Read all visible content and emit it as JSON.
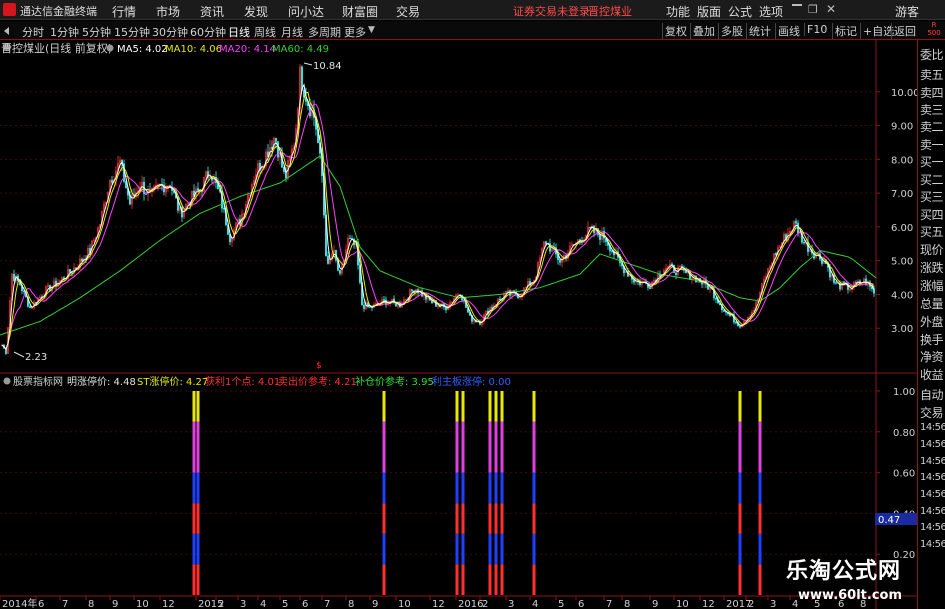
{
  "window": {
    "app_name": "通达信金融终端",
    "menu": [
      "行情",
      "市场",
      "资讯",
      "发现",
      "问小达",
      "财富圈",
      "交易"
    ],
    "warning": "证券交易未登录",
    "warning_stock": "晋控煤业",
    "right_menu": [
      "功能",
      "版面",
      "公式",
      "选项"
    ],
    "guest": "游客"
  },
  "toolbar": {
    "periods": [
      "分时",
      "1分钟",
      "5分钟",
      "15分钟",
      "30分钟",
      "60分钟",
      "日线",
      "周线",
      "月线",
      "多周期",
      "更多"
    ],
    "active_period": "日线",
    "right_buttons": [
      "复权",
      "叠加",
      "多股",
      "统计",
      "画线",
      "F10",
      "标记",
      "+自选",
      "返回"
    ],
    "corner_top": "R",
    "corner_bottom": "500"
  },
  "main_legend": {
    "stock": "晋控煤业(日线 前复权)",
    "ma5": "MA5: 4.02",
    "ma10": "MA10: 4.06",
    "ma20": "MA20: 4.14",
    "ma60": "MA60: 4.49"
  },
  "main_annotations": {
    "high": "10.84",
    "low": "2.23"
  },
  "sub_legend": {
    "name": "股票指标网",
    "items": [
      {
        "text": "明涨停价: 4.48",
        "color": "#e0e0e0"
      },
      {
        "text": "ST涨停价: 4.27",
        "color": "#e8e800"
      },
      {
        "text": "获利1个点: 4.01",
        "color": "#ff3030"
      },
      {
        "text": "卖出价参考: 4.21",
        "color": "#ff3030"
      },
      {
        "text": "补仓价参考: 3.95",
        "color": "#30e030"
      },
      {
        "text": "利主板涨停: 0.00",
        "color": "#3060ff"
      }
    ]
  },
  "sub_value_label": "0.47",
  "main_y_ticks": [
    "10.00",
    "9.00",
    "8.00",
    "7.00",
    "6.00",
    "5.00",
    "4.00",
    "3.00"
  ],
  "sub_y_ticks": [
    "1.00",
    "0.80",
    "0.60",
    "0.40",
    "0.20"
  ],
  "x_labels": [
    "2014年",
    "6",
    "7",
    "8",
    "9",
    "10",
    "12",
    "2015",
    "2",
    "3",
    "4",
    "5",
    "6",
    "7",
    "8",
    "9",
    "10",
    "12",
    "2016",
    "2",
    "3",
    "4",
    "5",
    "6",
    "7",
    "8",
    "9",
    "10",
    "12",
    "2017",
    "2",
    "3",
    "4",
    "5",
    "6",
    "8"
  ],
  "side_panel": {
    "items": [
      "委比",
      "卖五",
      "卖四",
      "卖三",
      "卖二",
      "卖一",
      "买一",
      "买二",
      "买三",
      "买四",
      "买五",
      "现价",
      "涨跌",
      "涨幅",
      "总量",
      "外盘",
      "换手",
      "净资",
      "收益",
      "自动",
      "交易",
      "14:56",
      "14:56",
      "14:56",
      "14:56",
      "14:56",
      "14:56",
      "14:56",
      "14:56"
    ]
  },
  "watermark": {
    "cn": "乐淘公式网",
    "url": "www.60lt.com"
  },
  "colors": {
    "axis_red": "#8b1515",
    "ma5": "#ffffff",
    "ma10": "#e8e800",
    "ma20": "#ff40ff",
    "ma60": "#30d030",
    "candle_up": "#ff3030",
    "candle_down": "#30ffff",
    "stripe_blue": "#2040ff"
  },
  "chart_data": [
    {
      "type": "candlestick",
      "title": "晋控煤业(日线 前复权)",
      "y_range": [
        2.0,
        11.0
      ],
      "annotations": [
        {
          "label": "10.84",
          "value": 10.84
        },
        {
          "label": "2.23",
          "value": 2.23
        }
      ],
      "close_path": [
        [
          0,
          2.6
        ],
        [
          6,
          2.3
        ],
        [
          12,
          4.6
        ],
        [
          20,
          4.3
        ],
        [
          30,
          3.6
        ],
        [
          45,
          4.1
        ],
        [
          60,
          4.4
        ],
        [
          75,
          4.8
        ],
        [
          90,
          5.3
        ],
        [
          100,
          6.1
        ],
        [
          110,
          7.4
        ],
        [
          120,
          7.9
        ],
        [
          130,
          6.7
        ],
        [
          140,
          7.3
        ],
        [
          150,
          6.9
        ],
        [
          160,
          7.2
        ],
        [
          170,
          7.3
        ],
        [
          180,
          6.4
        ],
        [
          190,
          6.8
        ],
        [
          200,
          7.1
        ],
        [
          210,
          7.7
        ],
        [
          220,
          6.9
        ],
        [
          230,
          5.7
        ],
        [
          240,
          6.2
        ],
        [
          255,
          7.6
        ],
        [
          265,
          8.1
        ],
        [
          275,
          8.7
        ],
        [
          285,
          7.4
        ],
        [
          295,
          8.6
        ],
        [
          300,
          10.5
        ],
        [
          308,
          9.7
        ],
        [
          315,
          9.2
        ],
        [
          322,
          7.5
        ],
        [
          327,
          4.7
        ],
        [
          333,
          5.3
        ],
        [
          340,
          4.5
        ],
        [
          348,
          5.6
        ],
        [
          356,
          5.4
        ],
        [
          362,
          3.7
        ],
        [
          370,
          3.6
        ],
        [
          385,
          3.8
        ],
        [
          400,
          3.7
        ],
        [
          415,
          4.2
        ],
        [
          430,
          3.8
        ],
        [
          445,
          3.6
        ],
        [
          460,
          4.1
        ],
        [
          470,
          3.3
        ],
        [
          480,
          3.2
        ],
        [
          490,
          3.6
        ],
        [
          505,
          4.0
        ],
        [
          520,
          4.0
        ],
        [
          535,
          4.5
        ],
        [
          545,
          5.6
        ],
        [
          560,
          5.0
        ],
        [
          575,
          5.5
        ],
        [
          590,
          5.9
        ],
        [
          605,
          5.7
        ],
        [
          620,
          4.9
        ],
        [
          635,
          4.4
        ],
        [
          650,
          4.3
        ],
        [
          665,
          4.8
        ],
        [
          680,
          4.7
        ],
        [
          695,
          4.5
        ],
        [
          710,
          4.2
        ],
        [
          725,
          3.5
        ],
        [
          740,
          3.1
        ],
        [
          755,
          3.6
        ],
        [
          765,
          4.5
        ],
        [
          775,
          5.2
        ],
        [
          785,
          5.7
        ],
        [
          795,
          6.1
        ],
        [
          805,
          5.5
        ],
        [
          815,
          5.2
        ],
        [
          825,
          5.0
        ],
        [
          835,
          4.3
        ],
        [
          850,
          4.2
        ],
        [
          865,
          4.4
        ],
        [
          876,
          4.0
        ]
      ],
      "ma60_path": [
        [
          0,
          2.8
        ],
        [
          40,
          3.2
        ],
        [
          80,
          3.9
        ],
        [
          120,
          4.7
        ],
        [
          160,
          5.6
        ],
        [
          200,
          6.4
        ],
        [
          240,
          6.9
        ],
        [
          280,
          7.3
        ],
        [
          305,
          7.8
        ],
        [
          320,
          8.1
        ],
        [
          340,
          7.2
        ],
        [
          360,
          5.4
        ],
        [
          380,
          4.7
        ],
        [
          420,
          4.2
        ],
        [
          460,
          3.9
        ],
        [
          500,
          4.0
        ],
        [
          540,
          4.2
        ],
        [
          580,
          4.6
        ],
        [
          600,
          5.2
        ],
        [
          620,
          5.0
        ],
        [
          660,
          4.6
        ],
        [
          700,
          4.4
        ],
        [
          740,
          3.9
        ],
        [
          760,
          3.8
        ],
        [
          780,
          4.2
        ],
        [
          800,
          4.8
        ],
        [
          820,
          5.3
        ],
        [
          850,
          5.1
        ],
        [
          876,
          4.49
        ]
      ],
      "ma5": 4.02,
      "ma10": 4.06,
      "ma20": 4.14,
      "ma60": 4.49
    },
    {
      "type": "bar",
      "title": "股票指标网",
      "y_range": [
        0.0,
        1.0
      ],
      "signal_positions": [
        194,
        198,
        384,
        457,
        463,
        490,
        496,
        502,
        534,
        740,
        760
      ],
      "bands": [
        {
          "from": 0.0,
          "to": 0.15,
          "color": "#ff3030"
        },
        {
          "from": 0.15,
          "to": 0.3,
          "color": "#2040ff"
        },
        {
          "from": 0.3,
          "to": 0.45,
          "color": "#ff3030"
        },
        {
          "from": 0.45,
          "to": 0.6,
          "color": "#2040ff"
        },
        {
          "from": 0.6,
          "to": 0.85,
          "color": "#e040e0"
        },
        {
          "from": 0.85,
          "to": 1.0,
          "color": "#e8e800"
        }
      ]
    }
  ]
}
